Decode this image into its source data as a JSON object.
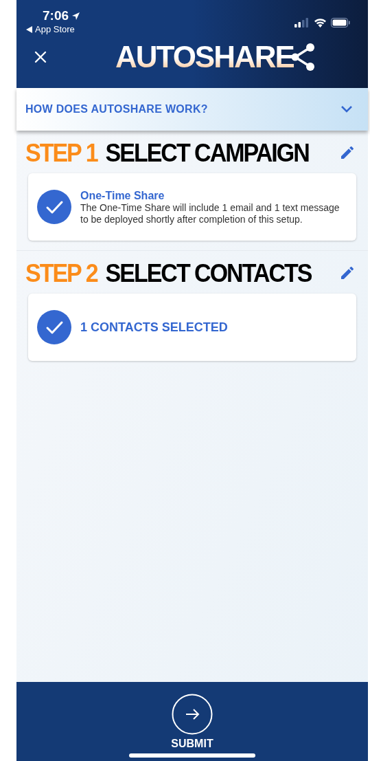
{
  "status_bar": {
    "time": "7:06",
    "back_link": "App Store"
  },
  "header": {
    "logo": "AUTOSHARE"
  },
  "accordion": {
    "label": "HOW DOES AUTOSHARE WORK?",
    "expanded": false
  },
  "steps": [
    {
      "step_label": "STEP 1",
      "title": "SELECT CAMPAIGN",
      "card": {
        "kind": "detail",
        "checked": true,
        "title": "One-Time Share",
        "description": "The One-Time Share will include 1 email and 1 text message to be deployed shortly after completion of this setup."
      }
    },
    {
      "step_label": "STEP 2",
      "title": "SELECT CONTACTS",
      "card": {
        "kind": "summary",
        "checked": true,
        "title": "1 CONTACTS SELECTED"
      }
    }
  ],
  "footer": {
    "submit_label": "SUBMIT"
  }
}
